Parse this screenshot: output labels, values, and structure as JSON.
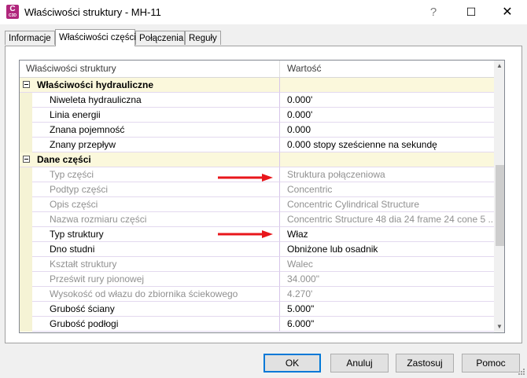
{
  "window": {
    "title": "Właściwości struktury - MH-11",
    "icon_top": "C",
    "icon_bottom": "C3D",
    "help_glyph": "?",
    "maximize_glyph": "☐",
    "close_glyph": "✕"
  },
  "tabs": [
    {
      "label": "Informacje",
      "active": false
    },
    {
      "label": "Właściwości części",
      "active": true
    },
    {
      "label": "Połączenia",
      "active": false
    },
    {
      "label": "Reguły",
      "active": false
    }
  ],
  "grid": {
    "headers": {
      "property": "Właściwości struktury",
      "value": "Wartość"
    },
    "rows": [
      {
        "type": "category",
        "label": "Właściwości hydrauliczne",
        "value": ""
      },
      {
        "type": "prop",
        "label": "Niweleta hydrauliczna",
        "value": "0.000'",
        "readonly": false
      },
      {
        "type": "prop",
        "label": "Linia energii",
        "value": "0.000'",
        "readonly": false
      },
      {
        "type": "prop",
        "label": "Znana pojemność",
        "value": "0.000",
        "readonly": false
      },
      {
        "type": "prop",
        "label": "Znany przepływ",
        "value": "0.000 stopy sześcienne na sekundę",
        "readonly": false
      },
      {
        "type": "category",
        "label": "Dane części",
        "value": ""
      },
      {
        "type": "prop",
        "label": "Typ części",
        "value": "Struktura połączeniowa",
        "readonly": true
      },
      {
        "type": "prop",
        "label": "Podtyp części",
        "value": "Concentric",
        "readonly": true
      },
      {
        "type": "prop",
        "label": "Opis części",
        "value": "Concentric Cylindrical Structure",
        "readonly": true
      },
      {
        "type": "prop",
        "label": "Nazwa rozmiaru części",
        "value": "Concentric Structure 48 dia 24 frame 24 cone 5 ...",
        "readonly": true
      },
      {
        "type": "prop",
        "label": "Typ struktury",
        "value": "Właz",
        "readonly": false
      },
      {
        "type": "prop",
        "label": "Dno studni",
        "value": "Obniżone lub osadnik",
        "readonly": false
      },
      {
        "type": "prop",
        "label": "Kształt struktury",
        "value": "Walec",
        "readonly": true
      },
      {
        "type": "prop",
        "label": "Prześwit rury pionowej",
        "value": "34.000\"",
        "readonly": true
      },
      {
        "type": "prop",
        "label": "Wysokość od włazu do zbiornika ściekowego",
        "value": "4.270'",
        "readonly": true
      },
      {
        "type": "prop",
        "label": "Grubość ściany",
        "value": "5.000\"",
        "readonly": false
      },
      {
        "type": "prop",
        "label": "Grubość podłogi",
        "value": "6.000\"",
        "readonly": false
      }
    ]
  },
  "annotations": {
    "arrow_color": "#e8161b"
  },
  "buttons": {
    "ok": "OK",
    "cancel": "Anuluj",
    "apply": "Zastosuj",
    "help": "Pomoc"
  }
}
